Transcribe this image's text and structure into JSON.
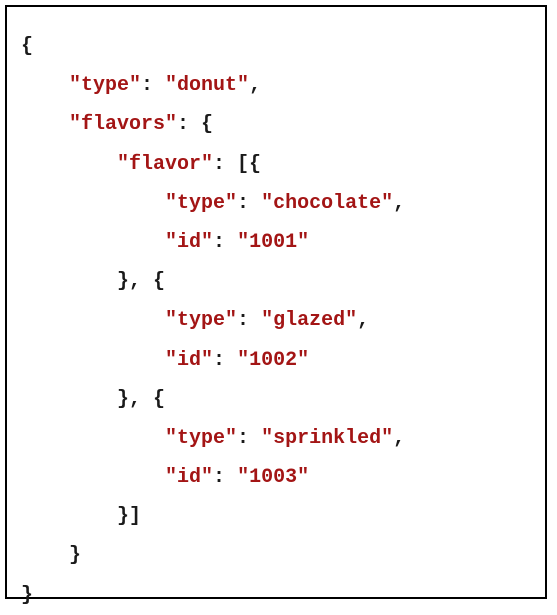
{
  "colors": {
    "punctuation": "#1a1a1a",
    "key": "#a31515",
    "string": "#a31515",
    "border": "#000000",
    "background": "#ffffff"
  },
  "code": {
    "lines": [
      {
        "indent": 0,
        "tokens": [
          {
            "t": "punct",
            "v": "{"
          }
        ]
      },
      {
        "indent": 1,
        "tokens": [
          {
            "t": "key",
            "v": "\"type\""
          },
          {
            "t": "punct",
            "v": ": "
          },
          {
            "t": "str",
            "v": "\"donut\""
          },
          {
            "t": "punct",
            "v": ","
          }
        ]
      },
      {
        "indent": 1,
        "tokens": [
          {
            "t": "key",
            "v": "\"flavors\""
          },
          {
            "t": "punct",
            "v": ": {"
          }
        ]
      },
      {
        "indent": 2,
        "tokens": [
          {
            "t": "key",
            "v": "\"flavor\""
          },
          {
            "t": "punct",
            "v": ": [{"
          }
        ]
      },
      {
        "indent": 3,
        "tokens": [
          {
            "t": "key",
            "v": "\"type\""
          },
          {
            "t": "punct",
            "v": ": "
          },
          {
            "t": "str",
            "v": "\"chocolate\""
          },
          {
            "t": "punct",
            "v": ","
          }
        ]
      },
      {
        "indent": 3,
        "tokens": [
          {
            "t": "key",
            "v": "\"id\""
          },
          {
            "t": "punct",
            "v": ": "
          },
          {
            "t": "str",
            "v": "\"1001\""
          }
        ]
      },
      {
        "indent": 2,
        "tokens": [
          {
            "t": "punct",
            "v": "}, {"
          }
        ]
      },
      {
        "indent": 3,
        "tokens": [
          {
            "t": "key",
            "v": "\"type\""
          },
          {
            "t": "punct",
            "v": ": "
          },
          {
            "t": "str",
            "v": "\"glazed\""
          },
          {
            "t": "punct",
            "v": ","
          }
        ]
      },
      {
        "indent": 3,
        "tokens": [
          {
            "t": "key",
            "v": "\"id\""
          },
          {
            "t": "punct",
            "v": ": "
          },
          {
            "t": "str",
            "v": "\"1002\""
          }
        ]
      },
      {
        "indent": 2,
        "tokens": [
          {
            "t": "punct",
            "v": "}, {"
          }
        ]
      },
      {
        "indent": 3,
        "tokens": [
          {
            "t": "key",
            "v": "\"type\""
          },
          {
            "t": "punct",
            "v": ": "
          },
          {
            "t": "str",
            "v": "\"sprinkled\""
          },
          {
            "t": "punct",
            "v": ","
          }
        ]
      },
      {
        "indent": 3,
        "tokens": [
          {
            "t": "key",
            "v": "\"id\""
          },
          {
            "t": "punct",
            "v": ": "
          },
          {
            "t": "str",
            "v": "\"1003\""
          }
        ]
      },
      {
        "indent": 2,
        "tokens": [
          {
            "t": "punct",
            "v": "}]"
          }
        ]
      },
      {
        "indent": 1,
        "tokens": [
          {
            "t": "punct",
            "v": "}"
          }
        ]
      },
      {
        "indent": 0,
        "tokens": [
          {
            "t": "punct",
            "v": "}"
          }
        ]
      }
    ]
  }
}
